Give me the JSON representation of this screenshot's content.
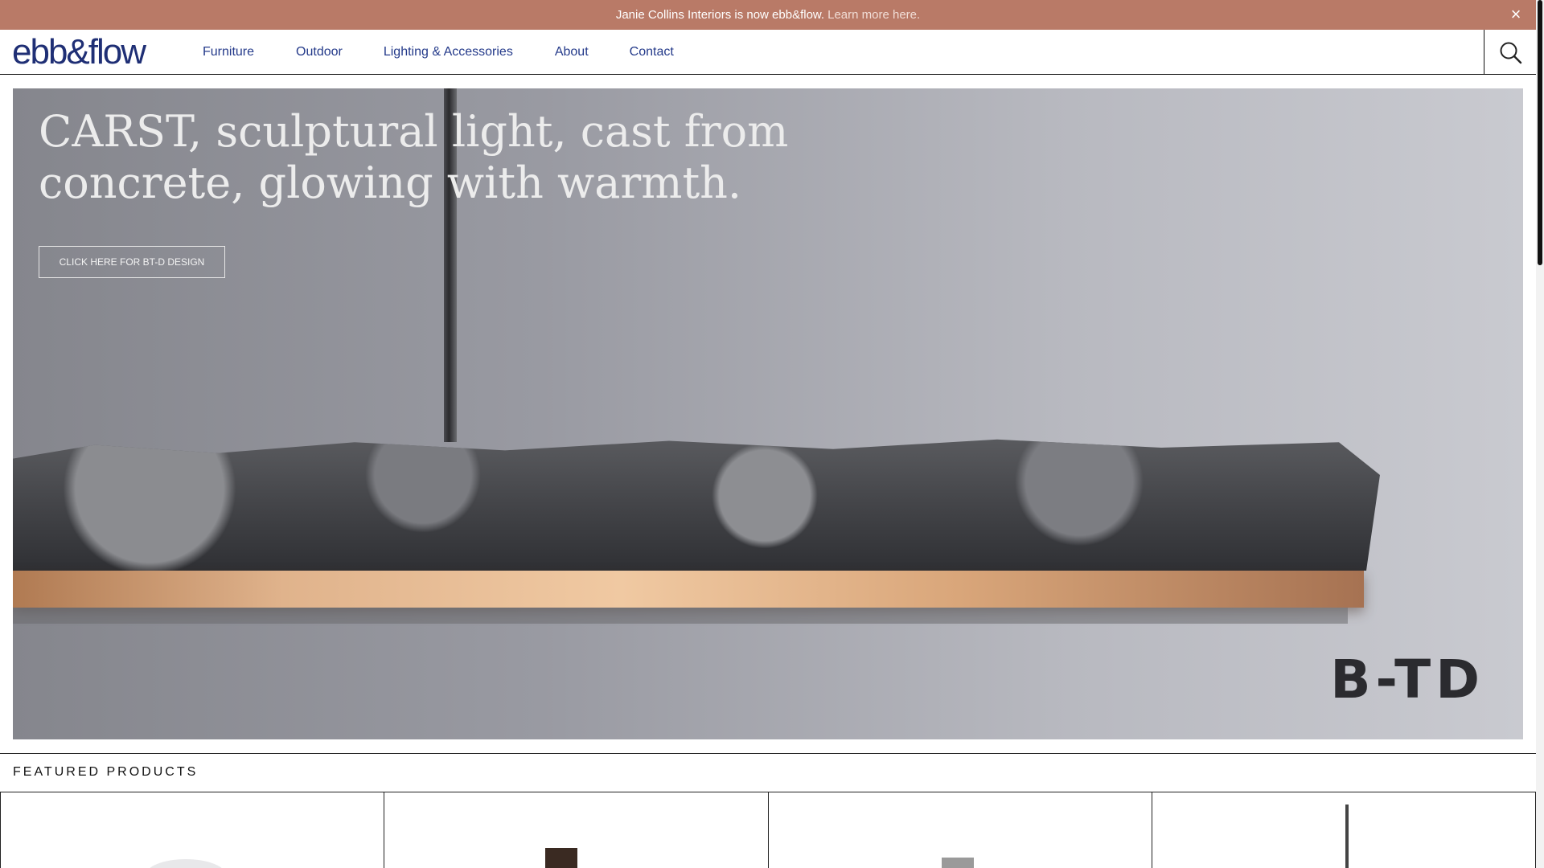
{
  "announcement": {
    "text": "Janie Collins Interiors is now ebb&flow.",
    "link_text": "Learn more here.",
    "close_symbol": "×"
  },
  "header": {
    "logo_text": "ebb&flow",
    "nav": [
      {
        "label": "Furniture"
      },
      {
        "label": "Outdoor"
      },
      {
        "label": "Lighting & Accessories"
      },
      {
        "label": "About"
      },
      {
        "label": "Contact"
      }
    ],
    "search_icon": "search-icon"
  },
  "hero": {
    "headline": "CARST, sculptural light, cast from concrete, glowing with warmth.",
    "cta_label": "CLICK HERE FOR BT-D DESIGN",
    "brand_mark": "B-TD"
  },
  "featured": {
    "title": "FEATURED PRODUCTS",
    "cards": [
      {
        "name": "product-1"
      },
      {
        "name": "product-2"
      },
      {
        "name": "product-3"
      },
      {
        "name": "product-4"
      }
    ]
  },
  "colors": {
    "announcement_bg": "#b97a67",
    "brand_blue": "#1f2f75",
    "nav_blue": "#243a8a"
  }
}
